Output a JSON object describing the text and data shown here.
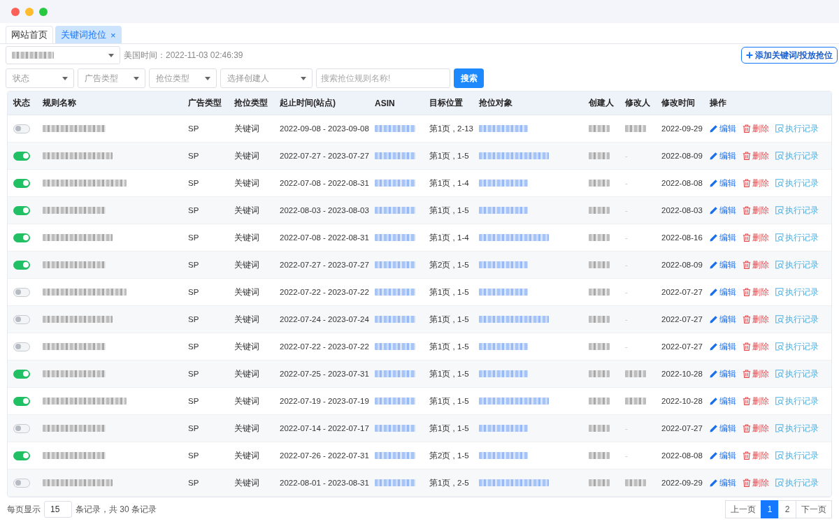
{
  "tabs": [
    {
      "label": "网站首页",
      "selected": false
    },
    {
      "label": "关键词抢位",
      "selected": true,
      "close": "×"
    }
  ],
  "toolbar": {
    "time": "美国时间：2022-11-03 02:46:39",
    "add_button": "添加关键词/投放抢位"
  },
  "filters": [
    {
      "kind": "select",
      "placeholder": "状态"
    },
    {
      "kind": "select",
      "placeholder": "广告类型"
    },
    {
      "kind": "select",
      "placeholder": "抢位类型"
    },
    {
      "kind": "select",
      "placeholder": "选择创建人"
    },
    {
      "kind": "input",
      "placeholder": "搜索抢位规则名称!"
    }
  ],
  "search_button": "搜索",
  "table": {
    "columns": [
      "状态",
      "规则名称",
      "广告类型",
      "抢位类型",
      "起止时间(站点)",
      "ASIN",
      "目标位置",
      "抢位对象",
      "创建人",
      "修改人",
      "修改时间",
      "操作"
    ],
    "rows": [
      {
        "enabled": false,
        "ad_type": "SP",
        "grab_type": "关键词",
        "period": "2022-09-08 - 2023-09-08",
        "position": "第1页 , 2-13",
        "modifier": {
          "blurred": true
        },
        "modified_time": "2022-09-29",
        "actions": [
          {
            "kind": "edit",
            "label": "编辑"
          },
          {
            "kind": "delete",
            "label": "删除"
          },
          {
            "kind": "log",
            "label": "执行记录"
          }
        ]
      },
      {
        "enabled": true,
        "ad_type": "SP",
        "grab_type": "关键词",
        "period": "2022-07-27 - 2023-07-27",
        "position": "第1页 , 1-5",
        "modifier": {
          "blurred": false,
          "text": "-"
        },
        "modified_time": "2022-08-09",
        "actions": [
          {
            "kind": "edit",
            "label": "编辑"
          },
          {
            "kind": "delete",
            "label": "删除"
          },
          {
            "kind": "log",
            "label": "执行记录"
          }
        ]
      },
      {
        "enabled": true,
        "ad_type": "SP",
        "grab_type": "关键词",
        "period": "2022-07-08 - 2022-08-31",
        "position": "第1页 , 1-4",
        "modifier": {
          "blurred": false,
          "text": "-"
        },
        "modified_time": "2022-08-08",
        "actions": [
          {
            "kind": "edit",
            "label": "编辑"
          },
          {
            "kind": "delete",
            "label": "删除"
          },
          {
            "kind": "log",
            "label": "执行记录"
          }
        ]
      },
      {
        "enabled": true,
        "ad_type": "SP",
        "grab_type": "关键词",
        "period": "2022-08-03 - 2023-08-03",
        "position": "第1页 , 1-5",
        "modifier": {
          "blurred": false,
          "text": "-"
        },
        "modified_time": "2022-08-03",
        "actions": [
          {
            "kind": "edit",
            "label": "编辑"
          },
          {
            "kind": "delete",
            "label": "删除"
          },
          {
            "kind": "log",
            "label": "执行记录"
          }
        ]
      },
      {
        "enabled": true,
        "ad_type": "SP",
        "grab_type": "关键词",
        "period": "2022-07-08 - 2022-08-31",
        "position": "第1页 , 1-4",
        "modifier": {
          "blurred": false,
          "text": "-"
        },
        "modified_time": "2022-08-16",
        "actions": [
          {
            "kind": "edit",
            "label": "编辑"
          },
          {
            "kind": "delete",
            "label": "删除"
          },
          {
            "kind": "log",
            "label": "执行记录"
          }
        ]
      },
      {
        "enabled": true,
        "ad_type": "SP",
        "grab_type": "关键词",
        "period": "2022-07-27 - 2023-07-27",
        "position": "第2页 , 1-5",
        "modifier": {
          "blurred": false,
          "text": "-"
        },
        "modified_time": "2022-08-09",
        "actions": [
          {
            "kind": "edit",
            "label": "编辑"
          },
          {
            "kind": "delete",
            "label": "删除"
          },
          {
            "kind": "log",
            "label": "执行记录"
          }
        ]
      },
      {
        "enabled": false,
        "ad_type": "SP",
        "grab_type": "关键词",
        "period": "2022-07-22 - 2023-07-22",
        "position": "第1页 , 1-5",
        "modifier": {
          "blurred": false,
          "text": "-"
        },
        "modified_time": "2022-07-27",
        "actions": [
          {
            "kind": "edit",
            "label": "编辑"
          },
          {
            "kind": "delete",
            "label": "删除"
          },
          {
            "kind": "log",
            "label": "执行记录"
          }
        ]
      },
      {
        "enabled": false,
        "ad_type": "SP",
        "grab_type": "关键词",
        "period": "2022-07-24 - 2023-07-24",
        "position": "第1页 , 1-5",
        "modifier": {
          "blurred": false,
          "text": "-"
        },
        "modified_time": "2022-07-27",
        "actions": [
          {
            "kind": "edit",
            "label": "编辑"
          },
          {
            "kind": "delete",
            "label": "删除"
          },
          {
            "kind": "log",
            "label": "执行记录"
          }
        ]
      },
      {
        "enabled": false,
        "ad_type": "SP",
        "grab_type": "关键词",
        "period": "2022-07-22 - 2023-07-22",
        "position": "第1页 , 1-5",
        "modifier": {
          "blurred": false,
          "text": "-"
        },
        "modified_time": "2022-07-27",
        "actions": [
          {
            "kind": "edit",
            "label": "编辑"
          },
          {
            "kind": "delete",
            "label": "删除"
          },
          {
            "kind": "log",
            "label": "执行记录"
          }
        ]
      },
      {
        "enabled": true,
        "ad_type": "SP",
        "grab_type": "关键词",
        "period": "2022-07-25 - 2023-07-31",
        "position": "第1页 , 1-5",
        "modifier": {
          "blurred": true
        },
        "modified_time": "2022-10-28",
        "actions": [
          {
            "kind": "edit",
            "label": "编辑"
          },
          {
            "kind": "delete",
            "label": "删除"
          },
          {
            "kind": "log",
            "label": "执行记录"
          }
        ]
      },
      {
        "enabled": true,
        "ad_type": "SP",
        "grab_type": "关键词",
        "period": "2022-07-19 - 2023-07-19",
        "position": "第1页 , 1-5",
        "modifier": {
          "blurred": true
        },
        "modified_time": "2022-10-28",
        "actions": [
          {
            "kind": "edit",
            "label": "编辑"
          },
          {
            "kind": "delete",
            "label": "删除"
          },
          {
            "kind": "log",
            "label": "执行记录"
          }
        ]
      },
      {
        "enabled": false,
        "ad_type": "SP",
        "grab_type": "关键词",
        "period": "2022-07-14 - 2022-07-17",
        "position": "第1页 , 1-5",
        "modifier": {
          "blurred": false,
          "text": "-"
        },
        "modified_time": "2022-07-27",
        "actions": [
          {
            "kind": "edit",
            "label": "编辑"
          },
          {
            "kind": "delete",
            "label": "删除"
          },
          {
            "kind": "log",
            "label": "执行记录"
          }
        ]
      },
      {
        "enabled": true,
        "ad_type": "SP",
        "grab_type": "关键词",
        "period": "2022-07-26 - 2022-07-31",
        "position": "第2页 , 1-5",
        "modifier": {
          "blurred": false,
          "text": "-"
        },
        "modified_time": "2022-08-08",
        "actions": [
          {
            "kind": "edit",
            "label": "编辑"
          },
          {
            "kind": "delete",
            "label": "删除"
          },
          {
            "kind": "log",
            "label": "执行记录"
          }
        ]
      },
      {
        "enabled": false,
        "ad_type": "SP",
        "grab_type": "关键词",
        "period": "2022-08-01 - 2023-08-31",
        "position": "第1页 , 2-5",
        "modifier": {
          "blurred": true
        },
        "modified_time": "2022-09-29",
        "actions": [
          {
            "kind": "edit",
            "label": "编辑"
          },
          {
            "kind": "delete",
            "label": "删除"
          },
          {
            "kind": "log",
            "label": "执行记录"
          }
        ]
      }
    ]
  },
  "footer": {
    "page_size_label": "每页显示",
    "page_size": "15",
    "records_text": "条记录，共 30 条记录",
    "pages": [
      {
        "label": "上一页",
        "selected": false
      },
      {
        "label": "1",
        "selected": true
      },
      {
        "label": "2",
        "selected": false
      },
      {
        "label": "下一页",
        "selected": false
      }
    ]
  }
}
